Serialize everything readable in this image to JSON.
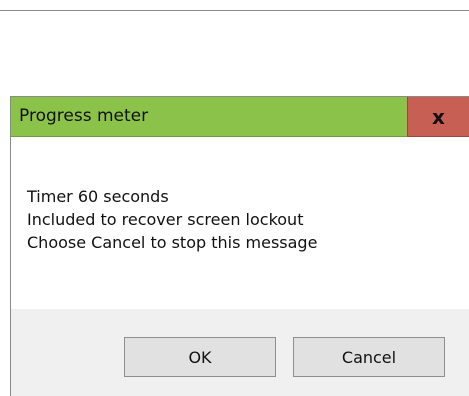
{
  "dialog": {
    "title": "Progress meter",
    "close_label": "x",
    "message_lines": [
      "Timer 60 seconds",
      "Included to recover screen lockout",
      "Choose Cancel to stop this message"
    ],
    "ok_label": "OK",
    "cancel_label": "Cancel"
  },
  "colors": {
    "title_bar": "#8bc34a",
    "close_button": "#c75f55",
    "body": "#ffffff",
    "button_area": "#f0f0f0"
  }
}
